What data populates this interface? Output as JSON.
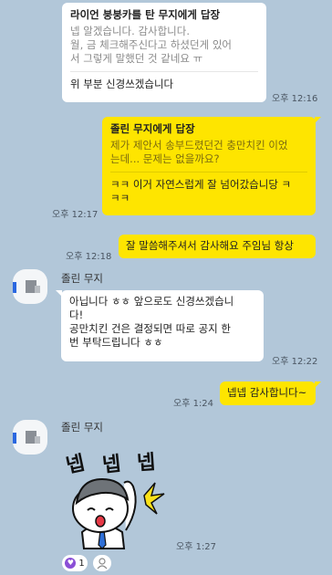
{
  "messages": {
    "m1": {
      "reply_title": "라이언 붕붕카를 탄 무지에게 답장",
      "quote_lines": [
        "넵 알겠습니다. 감사합니다.",
        "월, 금 체크해주신다고 하셨던게 있어",
        "서 그렇게 말했던 것 같네요 ㅠ"
      ],
      "text": "위 부분 신경쓰겠습니다",
      "time": "오후 12:16"
    },
    "m2": {
      "reply_title": "졸린 무지에게 답장",
      "quote_lines": [
        "제가 제안서 송부드렸던건 충만치킨 이었",
        "는데... 문제는 없을까요?"
      ],
      "text_lines": [
        "ㅋㅋ 이거 자연스럽게 잘 넘어갔습니당 ㅋ",
        "ㅋㅋ"
      ],
      "time": "오후 12:17"
    },
    "m3": {
      "text": "잘 말씀해주셔서 감사해요 주임님 항상",
      "time": "오후 12:18"
    },
    "m4": {
      "sender": "졸린 무지",
      "text_lines": [
        "아닙니다 ㅎㅎ 앞으로도 신경쓰겠습니",
        "다!",
        "공만치킨 건은 결정되면 따로 공지 한",
        "번 부탁드립니다 ㅎㅎ"
      ],
      "time": "오후 12:22"
    },
    "m5": {
      "text": "넵넵 감사합니다~",
      "time": "오후 1:24"
    },
    "m6": {
      "sender": "졸린 무지",
      "sticker_text": [
        "넵",
        "넵",
        "넵"
      ],
      "time": "오후 1:27",
      "reaction_count": "1"
    }
  }
}
